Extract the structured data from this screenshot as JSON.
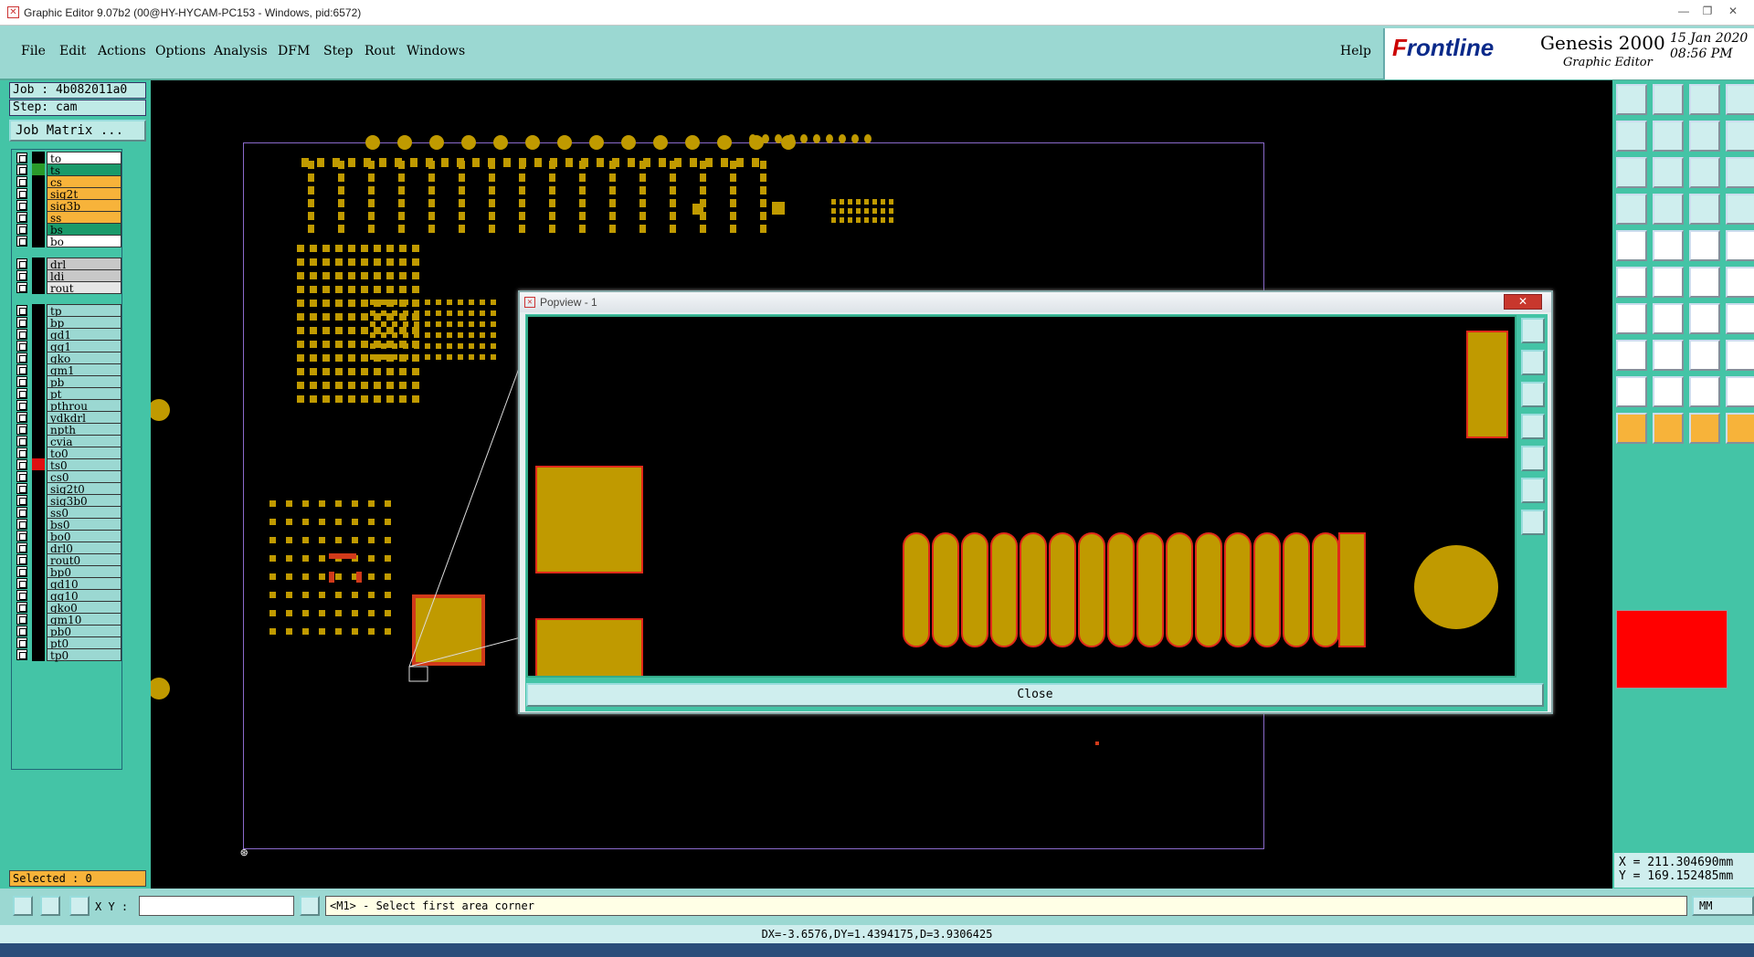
{
  "window": {
    "title": "Graphic Editor 9.07b2 (00@HY-HYCAM-PC153 - Windows, pid:6572)"
  },
  "menu": {
    "items": [
      "File",
      "Edit",
      "Actions",
      "Options",
      "Analysis",
      "DFM",
      "Step",
      "Rout",
      "Windows"
    ],
    "help": "Help"
  },
  "brand": {
    "logo_prefix": "F",
    "logo_rest": "rontline",
    "product": "Genesis 2000",
    "subtitle": "Graphic Editor",
    "date": "15 Jan 2020",
    "time": "08:56 PM"
  },
  "job": {
    "job": "Job : 4b082011a0",
    "step": "Step: cam",
    "matrix_button": "Job Matrix ..."
  },
  "layers": {
    "group1": [
      {
        "name": "to",
        "bg": "#ffffff",
        "color": "#000000"
      },
      {
        "name": "ts",
        "bg": "#1a9a6a",
        "color": "#2a9a2a",
        "active": true
      },
      {
        "name": "cs",
        "bg": "#f7b33a",
        "color": "#000000"
      },
      {
        "name": "sig2t",
        "bg": "#f7b33a",
        "color": "#000000"
      },
      {
        "name": "sig3b",
        "bg": "#f7b33a",
        "color": "#000000"
      },
      {
        "name": "ss",
        "bg": "#f7b33a",
        "color": "#000000"
      },
      {
        "name": "bs",
        "bg": "#1a9a6a",
        "color": "#000000"
      },
      {
        "name": "bo",
        "bg": "#ffffff",
        "color": "#000000"
      }
    ],
    "group2": [
      {
        "name": "drl",
        "bg": "#c8c8c8"
      },
      {
        "name": "ldi",
        "bg": "#c8c8c8"
      },
      {
        "name": "rout",
        "bg": "#e6e6e6"
      }
    ],
    "group3": [
      {
        "name": "tp"
      },
      {
        "name": "bp"
      },
      {
        "name": "gd1"
      },
      {
        "name": "gg1"
      },
      {
        "name": "gko"
      },
      {
        "name": "gm1"
      },
      {
        "name": "pb"
      },
      {
        "name": "pt"
      },
      {
        "name": "pthrou"
      },
      {
        "name": "ydkdrl"
      },
      {
        "name": "npth"
      },
      {
        "name": "cvia"
      },
      {
        "name": "to0"
      },
      {
        "name": "ts0",
        "color": "#e01010"
      },
      {
        "name": "cs0"
      },
      {
        "name": "sig2t0"
      },
      {
        "name": "sig3b0"
      },
      {
        "name": "ss0"
      },
      {
        "name": "bs0"
      },
      {
        "name": "bo0"
      },
      {
        "name": "drl0"
      },
      {
        "name": "rout0"
      },
      {
        "name": "bp0"
      },
      {
        "name": "gd10"
      },
      {
        "name": "gg10"
      },
      {
        "name": "gko0"
      },
      {
        "name": "gm10"
      },
      {
        "name": "pb0"
      },
      {
        "name": "pt0"
      },
      {
        "name": "tp0"
      }
    ]
  },
  "selected": "Selected : 0",
  "popview": {
    "title": "Popview - 1",
    "close": "Close"
  },
  "status": {
    "xy_label": "X Y :",
    "xy_value": "",
    "prompt": "<M1> - Select first area corner",
    "units": "MM"
  },
  "measure": "DX=-3.6576,DY=1.4394175,D=3.9306425",
  "coords": {
    "x": "X = 211.304690mm",
    "y": "Y = 169.152485mm"
  },
  "colors": {
    "teal": "#44c4a6",
    "pad": "#c09a00",
    "outline": "#e02a1a"
  }
}
